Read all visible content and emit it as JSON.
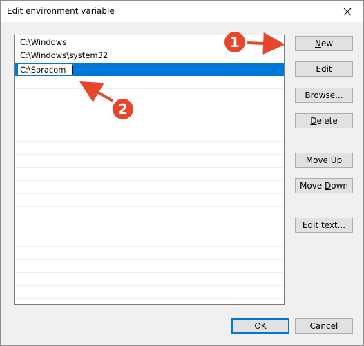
{
  "window": {
    "title": "Edit environment variable"
  },
  "list": {
    "items": [
      "C:\\Windows",
      "C:\\Windows\\system32"
    ],
    "editing_value": "C:\\Soracom"
  },
  "buttons": {
    "new": {
      "pre": "",
      "accel": "N",
      "post": "ew"
    },
    "edit": {
      "pre": "",
      "accel": "E",
      "post": "dit"
    },
    "browse": {
      "pre": "",
      "accel": "B",
      "post": "rowse..."
    },
    "delete": {
      "pre": "",
      "accel": "D",
      "post": "elete"
    },
    "move_up": {
      "pre": "Move ",
      "accel": "U",
      "post": "p"
    },
    "move_down": {
      "pre": "Move ",
      "accel": "D",
      "post": "own"
    },
    "edit_text": {
      "pre": "Edit ",
      "accel": "t",
      "post": "ext..."
    },
    "ok": "OK",
    "cancel": "Cancel"
  },
  "annotations": {
    "callout_1": "1",
    "callout_2": "2"
  },
  "colors": {
    "selection": "#0078d7",
    "callout": "#e8452c"
  }
}
